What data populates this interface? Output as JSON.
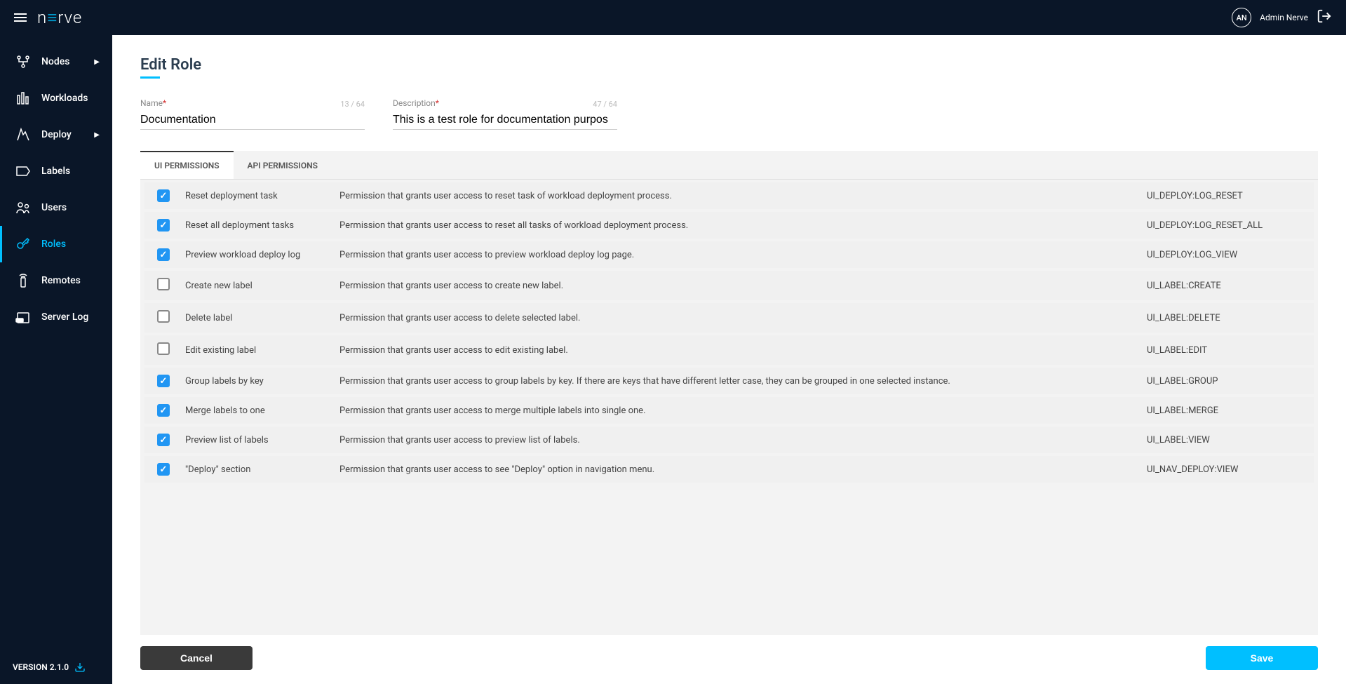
{
  "header": {
    "logo_text": "nerve",
    "avatar_initials": "AN",
    "username": "Admin Nerve"
  },
  "sidebar": {
    "items": [
      {
        "label": "Nodes",
        "has_chevron": true
      },
      {
        "label": "Workloads",
        "has_chevron": false
      },
      {
        "label": "Deploy",
        "has_chevron": true
      },
      {
        "label": "Labels",
        "has_chevron": false
      },
      {
        "label": "Users",
        "has_chevron": false
      },
      {
        "label": "Roles",
        "has_chevron": false,
        "active": true
      },
      {
        "label": "Remotes",
        "has_chevron": false
      },
      {
        "label": "Server Log",
        "has_chevron": false
      }
    ],
    "version_label": "VERSION 2.1.0"
  },
  "page": {
    "title": "Edit Role",
    "name_label": "Name",
    "name_value": "Documentation",
    "name_count": "13 / 64",
    "desc_label": "Description",
    "desc_value": "This is a test role for documentation purpos",
    "desc_count": "47 / 64",
    "tabs": [
      "UI PERMISSIONS",
      "API PERMISSIONS"
    ],
    "cancel_label": "Cancel",
    "save_label": "Save"
  },
  "permissions": [
    {
      "checked": true,
      "name": "Reset deployment task",
      "desc": "Permission that grants user access to reset task of workload deployment process.",
      "code": "UI_DEPLOY:LOG_RESET"
    },
    {
      "checked": true,
      "name": "Reset all deployment tasks",
      "desc": "Permission that grants user access to reset all tasks of workload deployment process.",
      "code": "UI_DEPLOY:LOG_RESET_ALL"
    },
    {
      "checked": true,
      "name": "Preview workload deploy log",
      "desc": "Permission that grants user access to preview workload deploy log page.",
      "code": "UI_DEPLOY:LOG_VIEW"
    },
    {
      "checked": false,
      "name": "Create new label",
      "desc": "Permission that grants user access to create new label.",
      "code": "UI_LABEL:CREATE"
    },
    {
      "checked": false,
      "name": "Delete label",
      "desc": "Permission that grants user access to delete selected label.",
      "code": "UI_LABEL:DELETE"
    },
    {
      "checked": false,
      "name": "Edit existing label",
      "desc": "Permission that grants user access to edit existing label.",
      "code": "UI_LABEL:EDIT"
    },
    {
      "checked": true,
      "name": "Group labels by key",
      "desc": "Permission that grants user access to group labels by key. If there are keys that have different letter case, they can be grouped in one selected instance.",
      "code": "UI_LABEL:GROUP"
    },
    {
      "checked": true,
      "name": "Merge labels to one",
      "desc": "Permission that grants user access to merge multiple labels into single one.",
      "code": "UI_LABEL:MERGE"
    },
    {
      "checked": true,
      "name": "Preview list of labels",
      "desc": "Permission that grants user access to preview list of labels.",
      "code": "UI_LABEL:VIEW"
    },
    {
      "checked": true,
      "name": "\"Deploy\" section",
      "desc": "Permission that grants user access to see \"Deploy\" option in navigation menu.",
      "code": "UI_NAV_DEPLOY:VIEW"
    }
  ]
}
